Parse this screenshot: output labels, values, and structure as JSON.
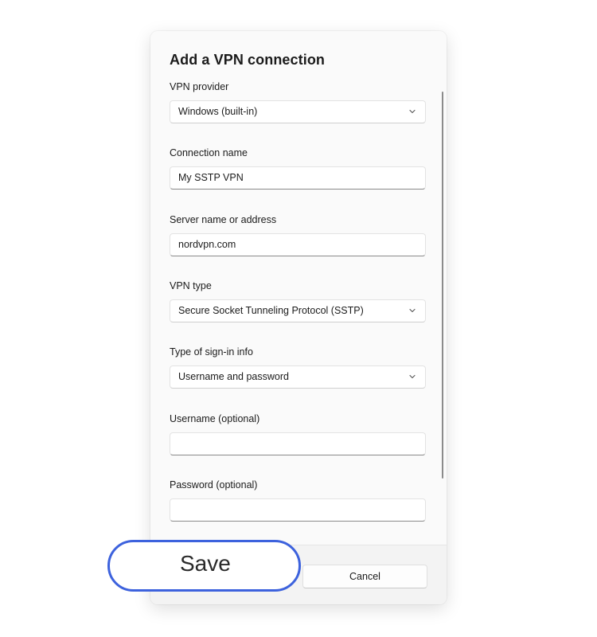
{
  "dialog": {
    "title": "Add a VPN connection",
    "fields": {
      "provider": {
        "label": "VPN provider",
        "value": "Windows (built-in)"
      },
      "connection_name": {
        "label": "Connection name",
        "value": "My SSTP VPN"
      },
      "server": {
        "label": "Server name or address",
        "value": "nordvpn.com"
      },
      "vpn_type": {
        "label": "VPN type",
        "value": "Secure Socket Tunneling Protocol (SSTP)"
      },
      "signin_type": {
        "label": "Type of sign-in info",
        "value": "Username and password"
      },
      "username": {
        "label": "Username (optional)",
        "value": ""
      },
      "password": {
        "label": "Password (optional)",
        "value": ""
      }
    },
    "footer": {
      "save_label": "Save",
      "cancel_label": "Cancel"
    }
  },
  "icons": {
    "dropdown": "chevron-down-icon"
  },
  "colors": {
    "highlight_ring": "#3d62dd",
    "dialog_background": "#fafafa",
    "footer_background": "#f3f3f3"
  }
}
